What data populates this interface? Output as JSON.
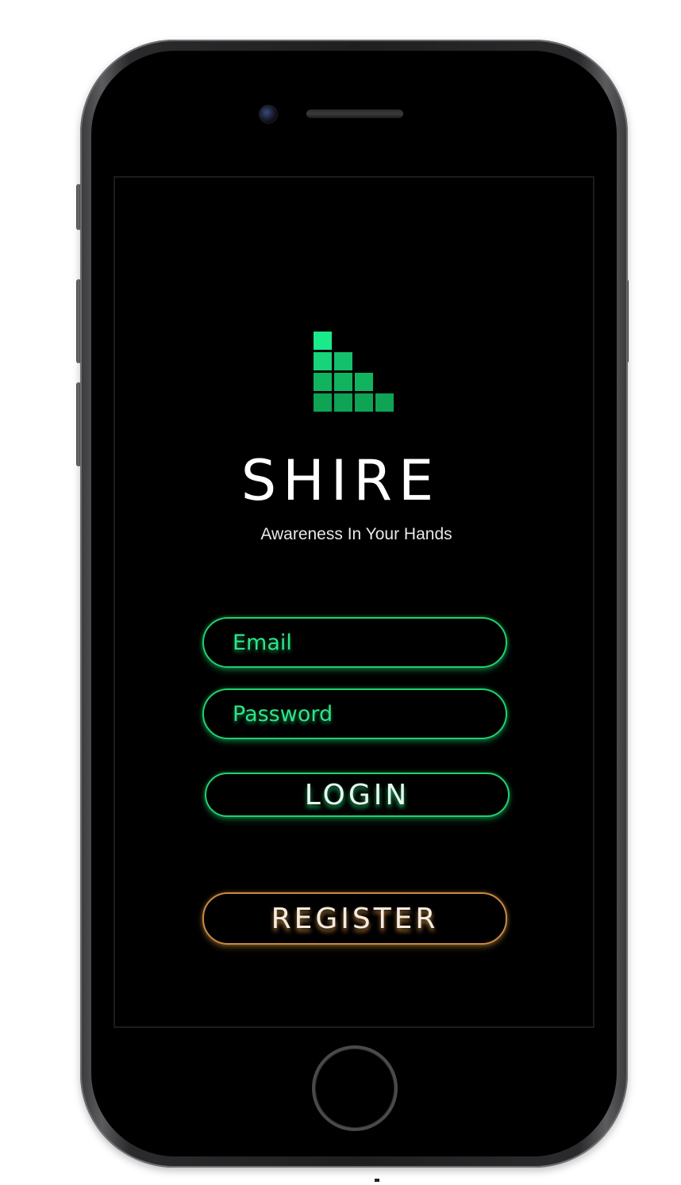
{
  "app": {
    "title": "SHIRE",
    "tagline": "Awareness In Your Hands",
    "logo_icon": "bar-blocks-logo-icon"
  },
  "form": {
    "email_placeholder": "Email",
    "password_placeholder": "Password",
    "login_label": "LOGIN",
    "register_label": "REGISTER"
  },
  "colors": {
    "background": "#000000",
    "accent_green": "#1fd16f",
    "accent_orange": "#c98b3f",
    "logo_green": "#11b35e"
  }
}
